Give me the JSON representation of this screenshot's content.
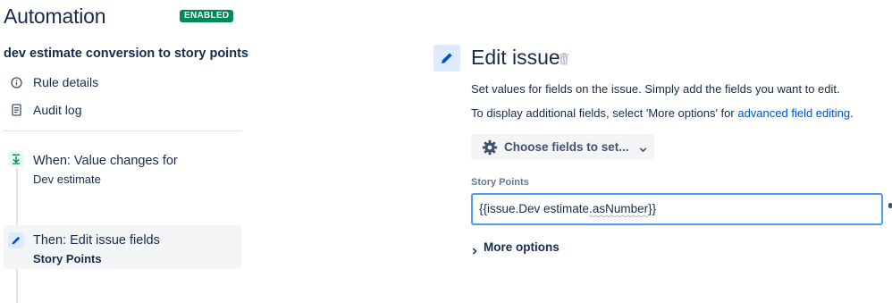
{
  "header": {
    "title": "Automation",
    "status_badge": "ENABLED"
  },
  "rule": {
    "name": "dev estimate conversion to story points"
  },
  "sidebar": {
    "links": [
      {
        "label": "Rule details",
        "icon": "info-icon"
      },
      {
        "label": "Audit log",
        "icon": "document-icon"
      }
    ],
    "steps": [
      {
        "title": "When: Value changes for",
        "subtitle": "Dev estimate",
        "icon": "trigger-icon",
        "color": "#e3fcef"
      },
      {
        "title": "Then: Edit issue fields",
        "subtitle": "Story Points",
        "icon": "pencil-icon",
        "color": "#deebff",
        "selected": true
      }
    ]
  },
  "panel": {
    "title": "Edit issue",
    "description": "Set values for fields on the issue. Simply add the fields you want to edit.",
    "additional_prefix": "To display additional fields, select 'More options' for ",
    "additional_link": "advanced field editing",
    "additional_suffix": ".",
    "choose_fields_label": "Choose fields to set...",
    "field": {
      "label": "Story Points",
      "value": "{{issue.Dev estimate.asNumber}}"
    },
    "more_options_label": "More options"
  },
  "colors": {
    "badge": "#00875a",
    "link": "#0052cc",
    "focus_border": "#4c9aff",
    "text": "#172b4d"
  }
}
